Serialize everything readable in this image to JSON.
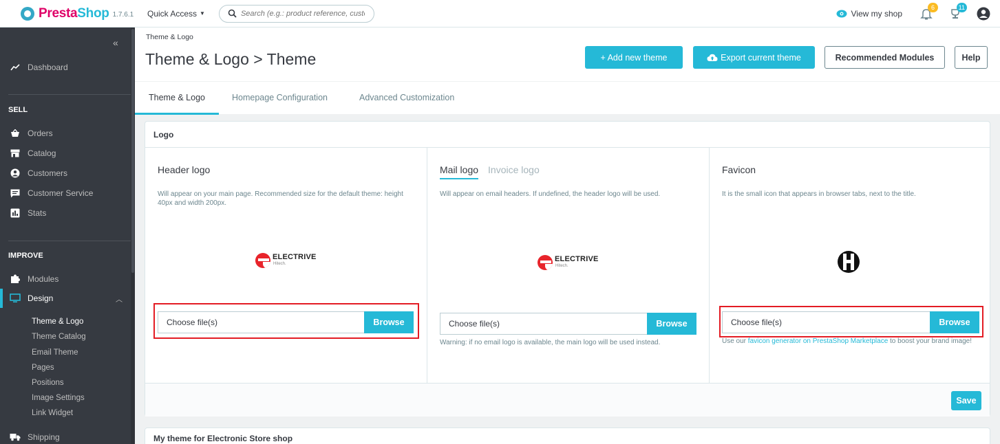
{
  "topbar": {
    "brand_name_part1": "Presta",
    "brand_name_part2": "Shop",
    "version": "1.7.6.1",
    "quick_access": "Quick Access",
    "search_placeholder": "Search (e.g.: product reference, custome",
    "view_shop": "View my shop",
    "notif_orders_count": "6",
    "notif_messages_count": "11"
  },
  "sidebar": {
    "dashboard": "Dashboard",
    "sell_section": "SELL",
    "sell_items": [
      "Orders",
      "Catalog",
      "Customers",
      "Customer Service",
      "Stats"
    ],
    "improve_section": "IMPROVE",
    "modules": "Modules",
    "design": "Design",
    "design_subitems": [
      "Theme & Logo",
      "Theme Catalog",
      "Email Theme",
      "Pages",
      "Positions",
      "Image Settings",
      "Link Widget"
    ],
    "shipping": "Shipping"
  },
  "header": {
    "breadcrumb": "Theme & Logo",
    "title": "Theme & Logo > Theme",
    "add_theme": "+ Add new theme",
    "export_theme": "Export current theme",
    "recommended": "Recommended Modules",
    "help": "Help"
  },
  "tabs": [
    "Theme & Logo",
    "Homepage Configuration",
    "Advanced Customization"
  ],
  "logo_panel": {
    "title": "Logo",
    "header_logo": {
      "title": "Header logo",
      "desc": "Will appear on your main page. Recommended size for the default theme: height 40px and width 200px.",
      "file_placeholder": "Choose file(s)",
      "browse": "Browse"
    },
    "mail_logo": {
      "tab_mail": "Mail logo",
      "tab_invoice": "Invoice logo",
      "desc": "Will appear on email headers. If undefined, the header logo will be used.",
      "file_placeholder": "Choose file(s)",
      "browse": "Browse",
      "warning": "Warning: if no email logo is available, the main logo will be used instead."
    },
    "favicon": {
      "title": "Favicon",
      "desc": "It is the small icon that appears in browser tabs, next to the title.",
      "file_placeholder": "Choose file(s)",
      "browse": "Browse",
      "note_prefix": "Use our ",
      "note_link": "favicon generator on PrestaShop Marketplace",
      "note_suffix": " to boost your brand image!"
    },
    "logo_brand": "ELECTRIVE",
    "logo_tagline": "Hitech.",
    "save": "Save"
  },
  "theme_panel": {
    "title": "My theme for Electronic Store shop"
  },
  "colors": {
    "accent": "#25b9d7",
    "sidebar_bg": "#363a41",
    "highlight": "#e31b23"
  }
}
